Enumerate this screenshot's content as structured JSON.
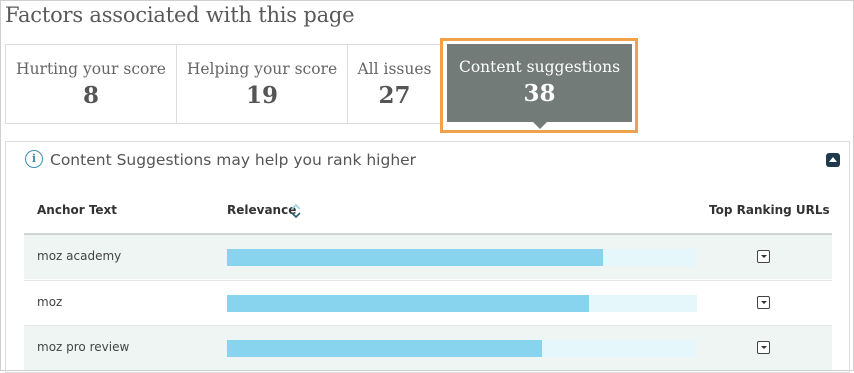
{
  "page": {
    "title": "Factors associated with this page"
  },
  "tabs": [
    {
      "label": "Hurting your score",
      "count": "8"
    },
    {
      "label": "Helping your score",
      "count": "19"
    },
    {
      "label": "All issues",
      "count": "27"
    },
    {
      "label": "Content suggestions",
      "count": "38",
      "active": true
    }
  ],
  "panel": {
    "info_icon": "info-icon",
    "title": "Content Suggestions may help you rank higher",
    "collapse_icon": "chevron-up-icon"
  },
  "table": {
    "headers": {
      "anchor": "Anchor Text",
      "relevance": "Relevance",
      "top_urls": "Top Ranking URLs"
    },
    "sort_icon": "sort-icon",
    "rows": [
      {
        "anchor": "moz academy",
        "relevance": 0.8
      },
      {
        "anchor": "moz",
        "relevance": 0.77
      },
      {
        "anchor": "moz pro review",
        "relevance": 0.67
      }
    ]
  },
  "colors": {
    "active_tab": "#737b78",
    "highlight": "#f0a24a",
    "relevance_bar": "#88d3ee",
    "relevance_track": "#e6f7fb"
  }
}
